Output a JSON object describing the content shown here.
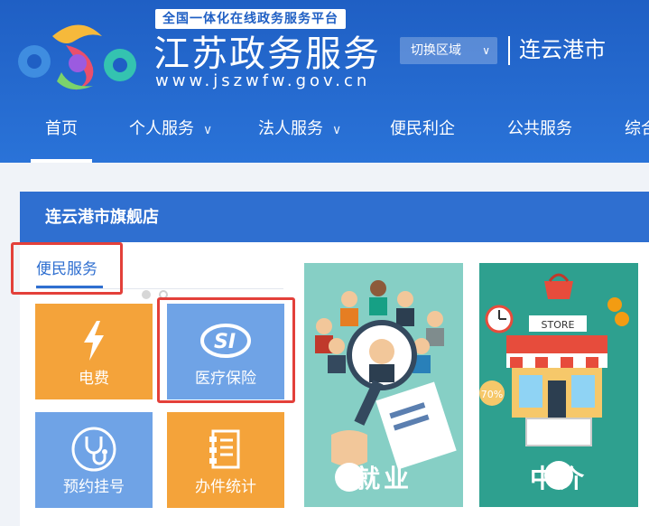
{
  "header": {
    "platform_badge": "全国一体化在线政务服务平台",
    "site_title": "江苏政务服务",
    "site_url": "www.jszwfw.gov.cn",
    "region_switch": "切换区域",
    "city": "连云港市"
  },
  "nav": {
    "items": [
      {
        "label": "首页",
        "active": true
      },
      {
        "label": "个人服务",
        "has_dropdown": true
      },
      {
        "label": "法人服务",
        "has_dropdown": true
      },
      {
        "label": "便民利企"
      },
      {
        "label": "公共服务"
      },
      {
        "label": "综合"
      }
    ]
  },
  "store": {
    "title": "连云港市旗舰店",
    "tab": "便民服务",
    "tiles": [
      {
        "label": "电费",
        "icon": "lightning-icon",
        "color": "#f4a33a"
      },
      {
        "label": "医疗保险",
        "icon": "si-icon",
        "color": "#6fa3e6"
      },
      {
        "label": "预约挂号",
        "icon": "stethoscope-icon",
        "color": "#6fa3e6"
      },
      {
        "label": "办件统计",
        "icon": "document-icon",
        "color": "#f4a33a"
      }
    ],
    "banners": [
      {
        "label": "就业",
        "background": "#86cfc5"
      },
      {
        "label": "中介",
        "background": "#2ea08f"
      }
    ],
    "store_sign": "STORE",
    "discount": "70%"
  },
  "colors": {
    "header_blue": "#1f5fc4",
    "panel_blue": "#2f6fd0",
    "highlight_red": "#e3403a"
  }
}
